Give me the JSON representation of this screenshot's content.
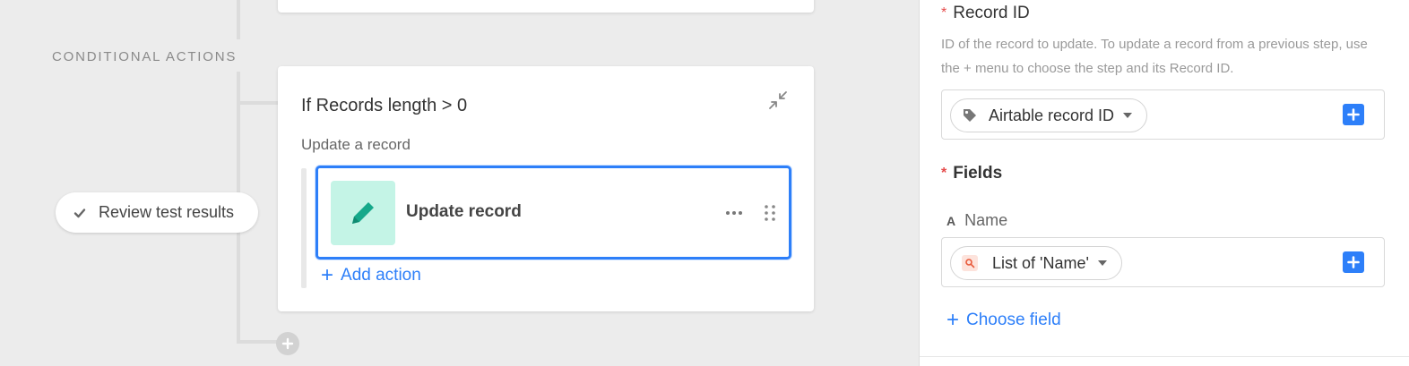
{
  "canvas": {
    "section_label": "CONDITIONAL ACTIONS",
    "review_button": "Review test results",
    "condition": {
      "title": "If Records length > 0",
      "subtitle": "Update a record",
      "action_label": "Update record",
      "add_action": "Add action"
    }
  },
  "panel": {
    "record_id": {
      "required_mark": "*",
      "title": "Record ID",
      "help": "ID of the record to update. To update a record from a previous step, use the + menu to choose the step and its Record ID.",
      "token": "Airtable record ID"
    },
    "fields": {
      "required_mark": "*",
      "title": "Fields",
      "name_field": {
        "type_glyph": "A",
        "label": "Name",
        "token": "List of 'Name'"
      },
      "choose_field": "Choose field"
    }
  },
  "colors": {
    "accent": "#2d7ff9",
    "action_icon_bg": "#c4f4e6",
    "action_icon": "#15a88a",
    "required": "#e54b4b"
  }
}
